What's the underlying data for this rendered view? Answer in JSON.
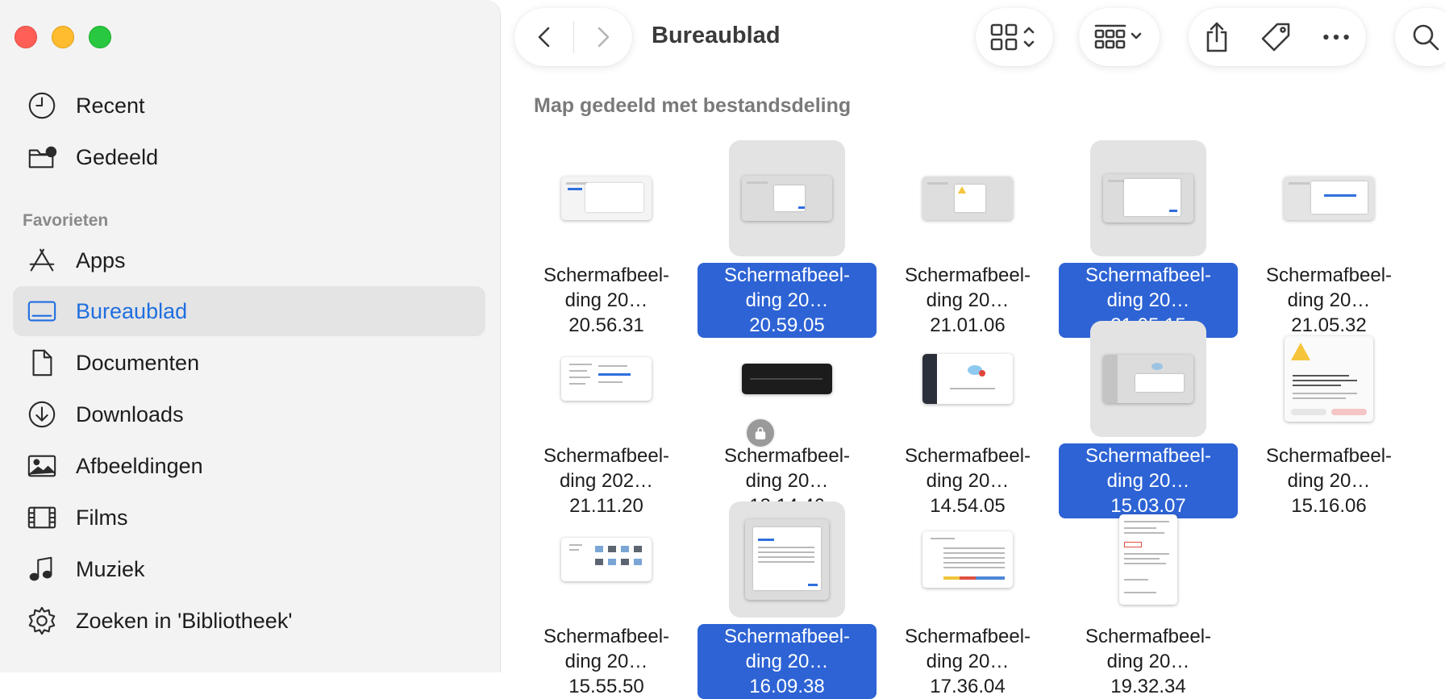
{
  "window": {
    "title": "Bureaublad",
    "group_info": "Map gedeeld met bestandsdeling"
  },
  "sidebar": {
    "items_top": [
      {
        "label": "Recent",
        "icon": "clock-icon"
      },
      {
        "label": "Gedeeld",
        "icon": "shared-folder-icon"
      }
    ],
    "favorites_header": "Favorieten",
    "favorites": [
      {
        "label": "Apps",
        "icon": "apps-icon"
      },
      {
        "label": "Bureaublad",
        "icon": "desktop-icon",
        "active": true
      },
      {
        "label": "Documenten",
        "icon": "document-icon"
      },
      {
        "label": "Downloads",
        "icon": "download-icon"
      },
      {
        "label": "Afbeeldingen",
        "icon": "photo-icon"
      },
      {
        "label": "Films",
        "icon": "film-icon"
      },
      {
        "label": "Muziek",
        "icon": "music-icon"
      },
      {
        "label": "Zoeken in 'Bibliotheek'",
        "icon": "gear-icon"
      }
    ]
  },
  "toolbar": {
    "icons": [
      "back-icon",
      "forward-icon",
      "icon-view-icon",
      "group-icon",
      "share-icon",
      "tag-icon",
      "more-icon",
      "search-icon"
    ]
  },
  "files": [
    {
      "line1": "Schermafbeel-",
      "line2": "ding 20…20.56.31",
      "selected": false
    },
    {
      "line1": "Schermafbeel-",
      "line2": "ding 20…20.59.05",
      "selected": true
    },
    {
      "line1": "Schermafbeel-",
      "line2": "ding 20…21.01.06",
      "selected": false
    },
    {
      "line1": "Schermafbeel-",
      "line2": "ding 20…21.05.15",
      "selected": true
    },
    {
      "line1": "Schermafbeel-",
      "line2": "ding 20…21.05.32",
      "selected": false
    },
    {
      "line1": "Schermafbeel-",
      "line2": "ding 202…21.11.20",
      "selected": false
    },
    {
      "line1": "Schermafbeel-",
      "line2": "ding 20…13.14.46",
      "selected": false,
      "locked": true
    },
    {
      "line1": "Schermafbeel-",
      "line2": "ding 20…14.54.05",
      "selected": false
    },
    {
      "line1": "Schermafbeel-",
      "line2": "ding 20…15.03.07",
      "selected": true
    },
    {
      "line1": "Schermafbeel-",
      "line2": "ding 20…15.16.06",
      "selected": false
    },
    {
      "line1": "Schermafbeel-",
      "line2": "ding 20…15.55.50",
      "selected": false
    },
    {
      "line1": "Schermafbeel-",
      "line2": "ding 20…16.09.38",
      "selected": true
    },
    {
      "line1": "Schermafbeel-",
      "line2": "ding 20…17.36.04",
      "selected": false
    },
    {
      "line1": "Schermafbeel-",
      "line2": "ding 20…19.32.34",
      "selected": false
    }
  ],
  "colors": {
    "selection": "#2d63d4",
    "accent": "#1f6ee0",
    "sidebar_bg": "#f3f3f3"
  }
}
